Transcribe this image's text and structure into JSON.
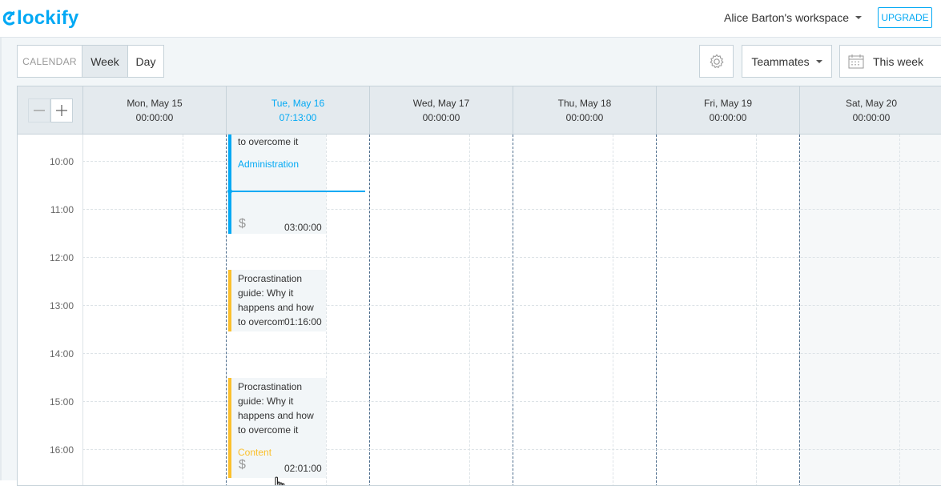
{
  "header": {
    "logo_text": "lockify",
    "workspace": "Alice Barton's workspace",
    "upgrade": "UPGRADE"
  },
  "toolbar": {
    "calendar_label": "CALENDAR",
    "week": "Week",
    "day": "Day",
    "teammates": "Teammates",
    "this_week": "This week"
  },
  "days": [
    {
      "name": "Mon, May 15",
      "total": "00:00:00"
    },
    {
      "name": "Tue, May 16",
      "total": "07:13:00"
    },
    {
      "name": "Wed, May 17",
      "total": "00:00:00"
    },
    {
      "name": "Thu, May 18",
      "total": "00:00:00"
    },
    {
      "name": "Fri, May 19",
      "total": "00:00:00"
    },
    {
      "name": "Sat, May 20",
      "total": "00:00:00"
    }
  ],
  "hours": [
    "10:00",
    "11:00",
    "12:00",
    "13:00",
    "14:00",
    "15:00",
    "16:00"
  ],
  "entries": [
    {
      "text": "to overcome it",
      "project": "Administration",
      "billable_symbol": "$",
      "duration": "03:00:00",
      "color": "#03a9f4"
    },
    {
      "text": "Procrastination guide: Why it happens and how to overcom",
      "duration": "01:16:00",
      "color": "#fbc02d"
    },
    {
      "text": "Procrastination guide: Why it happens and how to overcome it",
      "project": "Content",
      "billable_symbol": "$",
      "duration": "02:01:00",
      "color": "#fbc02d"
    }
  ],
  "colors": {
    "accent": "#03a9f4",
    "content": "#fbc02d"
  }
}
